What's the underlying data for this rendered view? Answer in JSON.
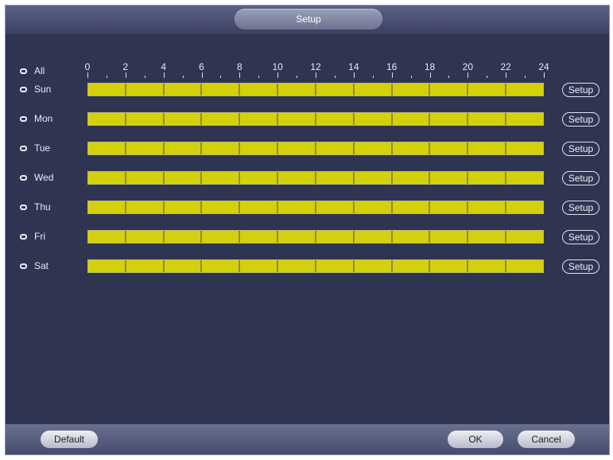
{
  "window": {
    "title": "Setup"
  },
  "timeline": {
    "ticks": [
      "0",
      "2",
      "4",
      "6",
      "8",
      "10",
      "12",
      "14",
      "16",
      "18",
      "20",
      "22",
      "24"
    ]
  },
  "select_all_label": "All",
  "days": [
    {
      "label": "Sun",
      "setup": "Setup"
    },
    {
      "label": "Mon",
      "setup": "Setup"
    },
    {
      "label": "Tue",
      "setup": "Setup"
    },
    {
      "label": "Wed",
      "setup": "Setup"
    },
    {
      "label": "Thu",
      "setup": "Setup"
    },
    {
      "label": "Fri",
      "setup": "Setup"
    },
    {
      "label": "Sat",
      "setup": "Setup"
    }
  ],
  "footer": {
    "default_label": "Default",
    "ok_label": "OK",
    "cancel_label": "Cancel"
  },
  "colors": {
    "schedule_fill": "#d4d10c",
    "background": "#2f3450"
  }
}
